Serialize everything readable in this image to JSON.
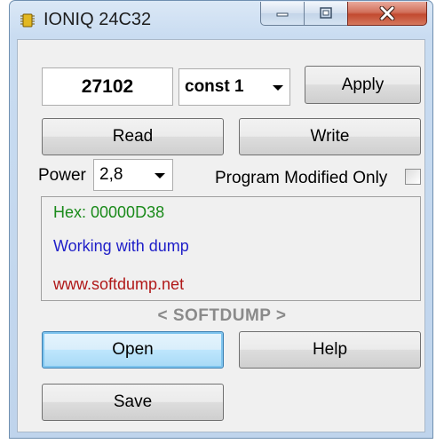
{
  "window": {
    "title": "IONIQ 24C32",
    "controls": {
      "minimize": "minimize",
      "maximize": "maximize",
      "close": "close"
    }
  },
  "value_field": {
    "value": "27102"
  },
  "mode_select": {
    "selected": "const 1"
  },
  "buttons": {
    "apply": "Apply",
    "read": "Read",
    "write": "Write",
    "open": "Open",
    "help": "Help",
    "save": "Save"
  },
  "power": {
    "label": "Power",
    "selected": "2,8"
  },
  "program_modified_only": {
    "label": "Program Modified Only",
    "checked": false
  },
  "info": {
    "hex": "Hex: 00000D38",
    "status": "Working with dump",
    "website": "www.softdump.net"
  },
  "brand": "< SOFTDUMP >",
  "colors": {
    "hex_text": "#1a8a1a",
    "status_text": "#1f1fc8",
    "website_text": "#b01818",
    "brand_text": "#8a8a8a"
  },
  "icons": [
    "chip-icon",
    "minimize-icon",
    "maximize-icon",
    "close-icon",
    "chevron-down-icon"
  ]
}
